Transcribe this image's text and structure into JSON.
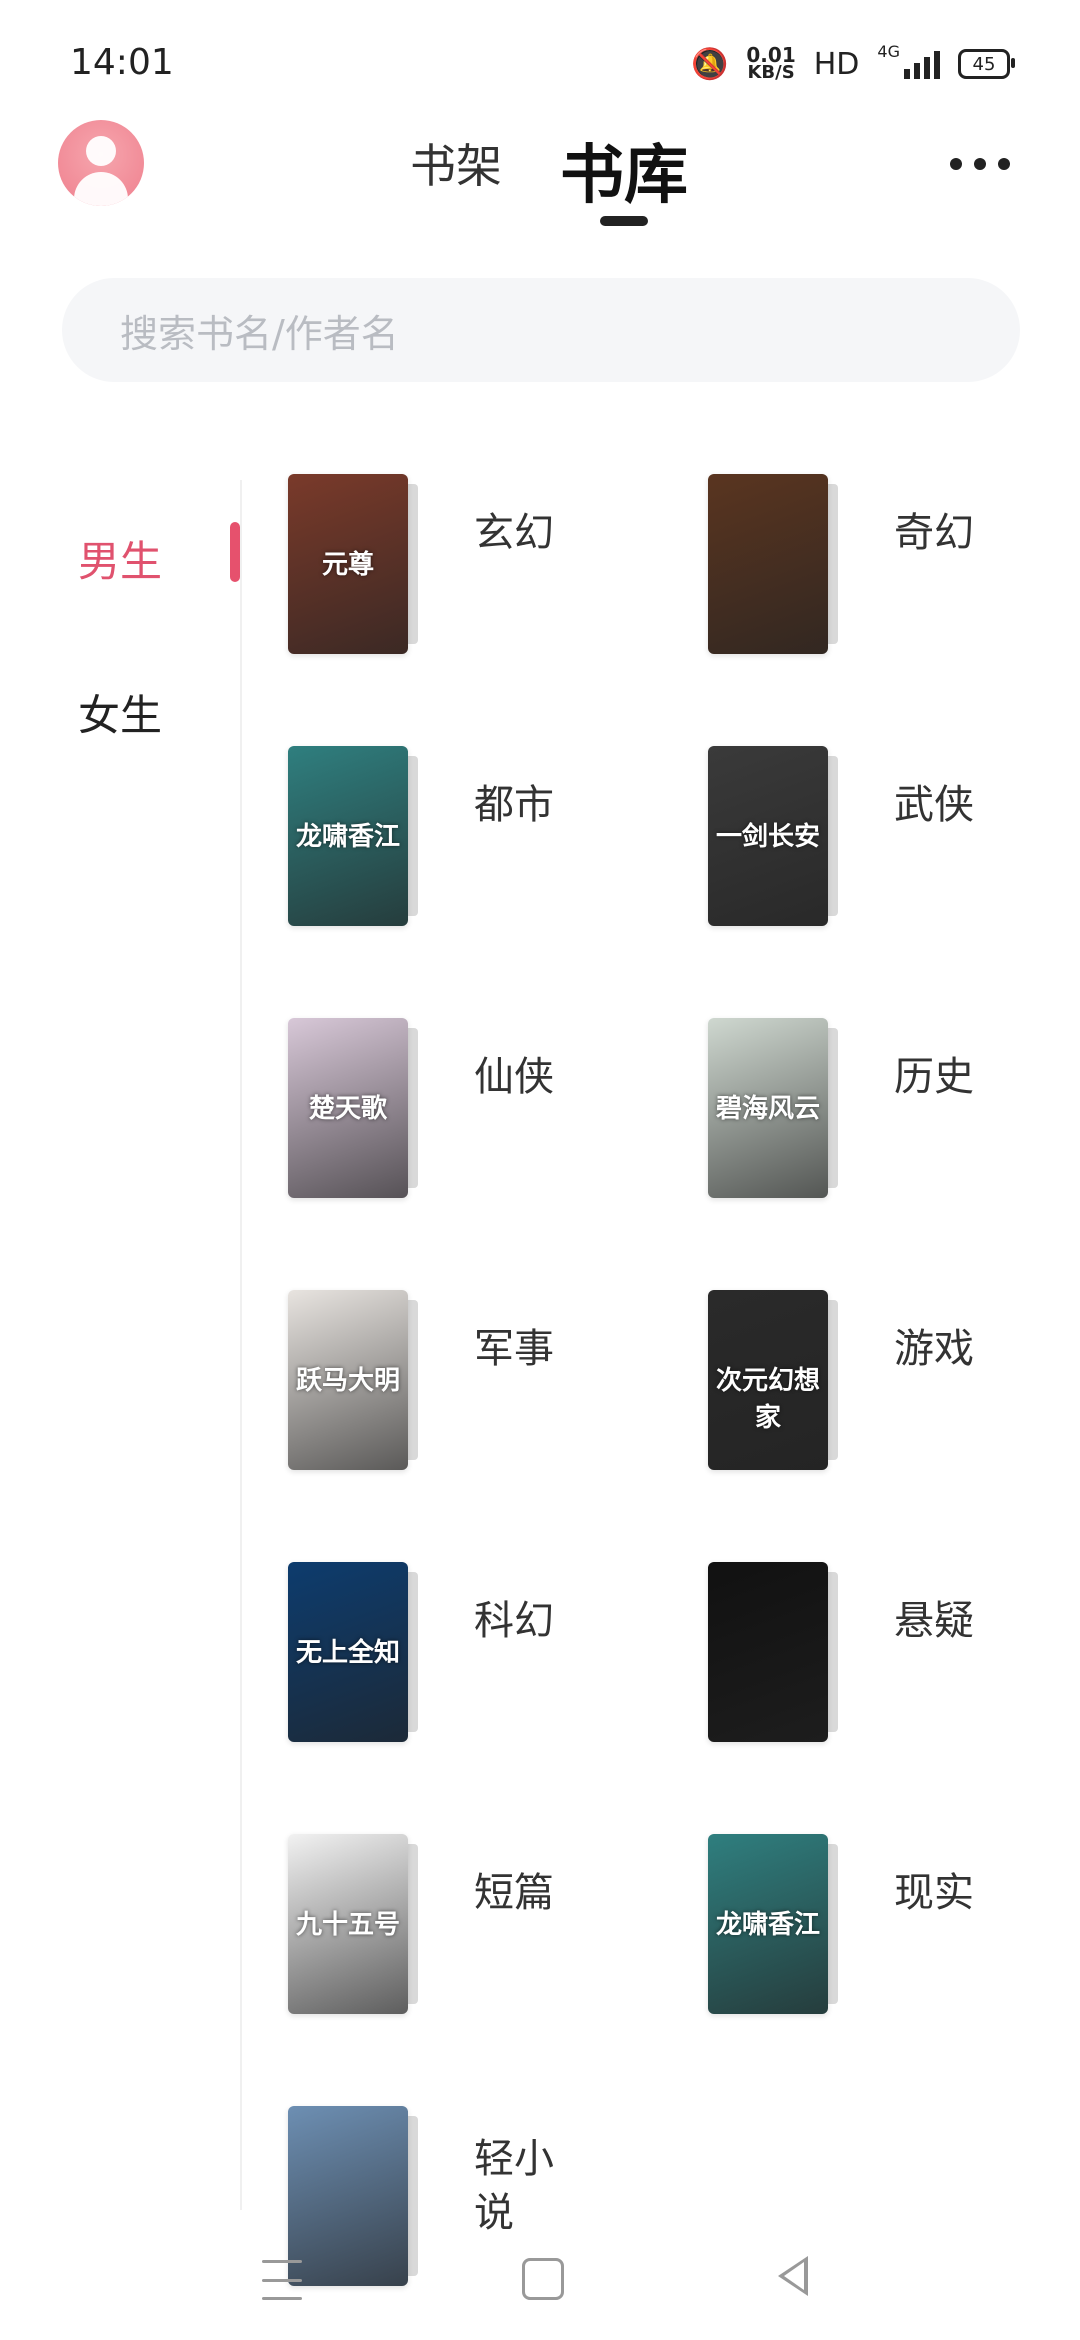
{
  "status_bar": {
    "time": "14:01",
    "net_speed_value": "0.01",
    "net_speed_unit": "KB/S",
    "hd": "HD",
    "network": "4G",
    "battery": "45"
  },
  "header": {
    "tab_shelf": "书架",
    "tab_library": "书库",
    "more_icon": "more-dots-icon"
  },
  "search": {
    "placeholder": "搜索书名/作者名"
  },
  "side_tabs": {
    "male": "男生",
    "female": "女生",
    "active_color": "#e0526e"
  },
  "categories": [
    {
      "label": "玄幻",
      "cover_text": "元尊",
      "cover_color": "#7a3a2a"
    },
    {
      "label": "奇幻",
      "cover_text": "",
      "cover_color": "#5a3520"
    },
    {
      "label": "都市",
      "cover_text": "龙啸香江",
      "cover_color": "#2f7f7f"
    },
    {
      "label": "武侠",
      "cover_text": "一剑长安",
      "cover_color": "#3a3a3a"
    },
    {
      "label": "仙侠",
      "cover_text": "楚天歌",
      "cover_color": "#d8c8d8"
    },
    {
      "label": "历史",
      "cover_text": "碧海风云",
      "cover_color": "#cfd8d0"
    },
    {
      "label": "军事",
      "cover_text": "跃马大明",
      "cover_color": "#e8e4e0"
    },
    {
      "label": "游戏",
      "cover_text": "次元幻想家",
      "cover_color": "#2a2a2a"
    },
    {
      "label": "科幻",
      "cover_text": "无上全知",
      "cover_color": "#0d3c6e"
    },
    {
      "label": "悬疑",
      "cover_text": "",
      "cover_color": "#111111"
    },
    {
      "label": "短篇",
      "cover_text": "九十五号",
      "cover_color": "#f2f2f2"
    },
    {
      "label": "现实",
      "cover_text": "龙啸香江",
      "cover_color": "#2f7f7f"
    },
    {
      "label": "轻小说",
      "cover_text": "",
      "cover_color": "#6d8fb3"
    }
  ]
}
